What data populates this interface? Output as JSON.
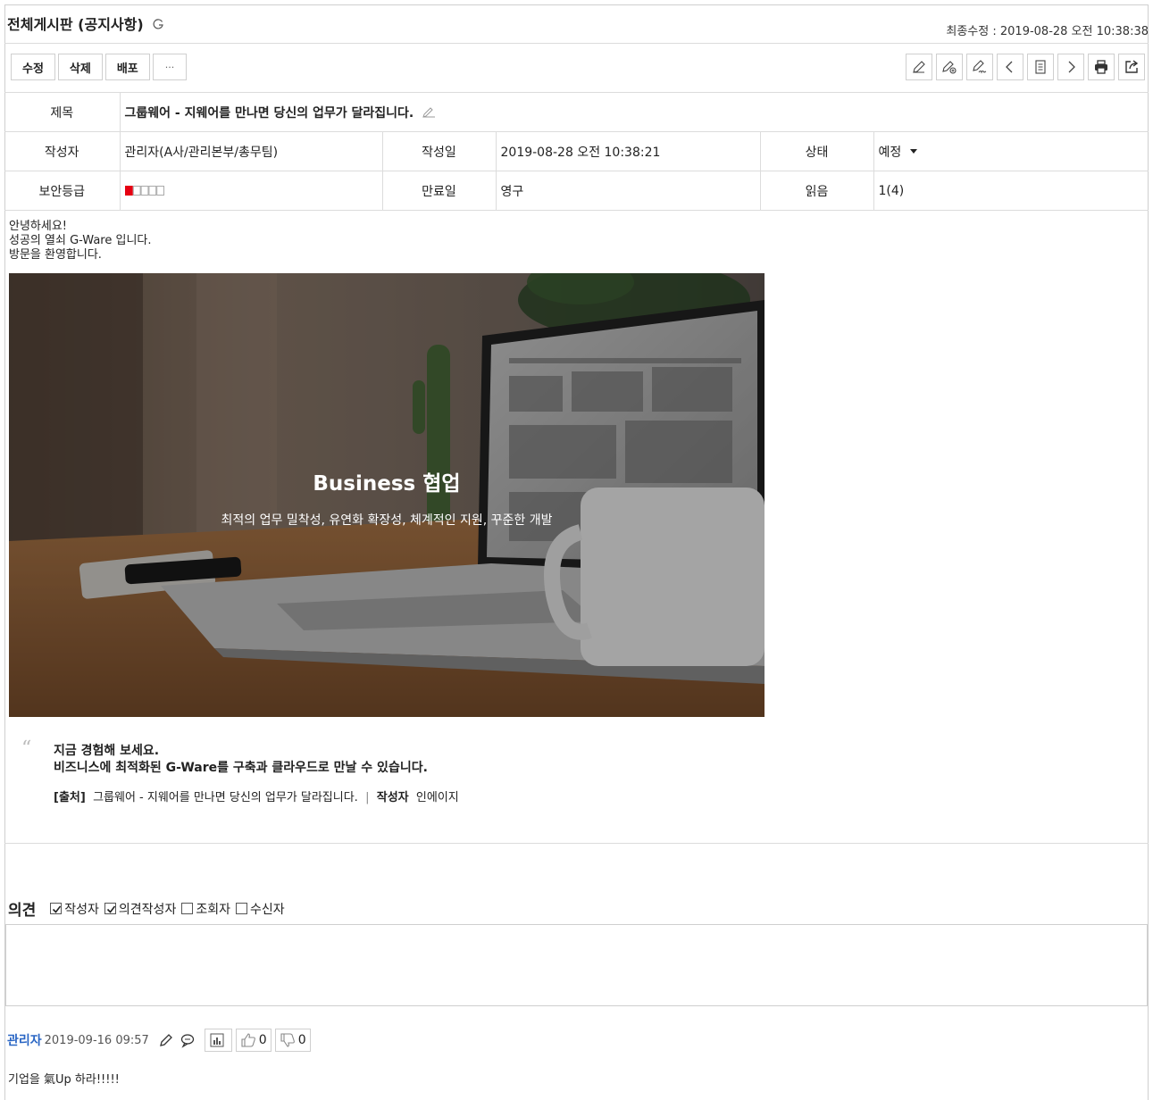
{
  "header": {
    "title": "전체게시판 (공지사항)",
    "last_modified": "최종수정 : 2019-08-28 오전 10:38:38"
  },
  "toolbar": {
    "edit_label": "수정",
    "delete_label": "삭제",
    "distribute_label": "배포",
    "more_label": "···",
    "icons": [
      "pencil-icon",
      "pencil-share-icon",
      "pencil-sign-icon",
      "chevron-left-icon",
      "list-doc-icon",
      "chevron-right-icon",
      "print-icon",
      "export-icon"
    ]
  },
  "meta": {
    "subject_label": "제목",
    "subject": "그룹웨어 - 지웨어를 만나면 당신의 업무가 달라집니다.",
    "writer_label": "작성자",
    "writer": "관리자(A사/관리본부/총무팀)",
    "written_label": "작성일",
    "written": "2019-08-28 오전 10:38:21",
    "status_label": "상태",
    "status": "예정",
    "security_label": "보안등급",
    "security_level": 1,
    "security_max": 5,
    "security_color": "#e60012",
    "expire_label": "만료일",
    "expire": "영구",
    "read_label": "읽음",
    "read": "1(4)"
  },
  "content": {
    "line1": "안녕하세요!",
    "line2": "성공의 열쇠 G-Ware 입니다.",
    "line3": "방문을 환영합니다.",
    "hero_title": "Business 협업",
    "hero_sub": "최적의 업무 밀착성, 유연화 확장성, 체계적인 지원, 꾸준한 개발",
    "quote_line1": "지금 경험해 보세요.",
    "quote_line2": "비즈니스에 최적화된 G-Ware를 구축과 클라우드로 만날 수 있습니다.",
    "source_label": "[출처]",
    "source_text": "그룹웨어 - 지웨어를 만나면 당신의 업무가 달라집니다.",
    "source_sep": "|",
    "source_author_label": "작성자",
    "source_author": "인에이지"
  },
  "opinion": {
    "title": "의견",
    "filters": [
      {
        "label": "작성자",
        "checked": true
      },
      {
        "label": "의견작성자",
        "checked": true
      },
      {
        "label": "조회자",
        "checked": false
      },
      {
        "label": "수신자",
        "checked": false
      }
    ]
  },
  "comment": {
    "author": "관리자",
    "date": "2019-09-16 09:57",
    "like_count": "0",
    "dislike_count": "0",
    "text": "기업을 氣Up 하라!!!!!"
  }
}
